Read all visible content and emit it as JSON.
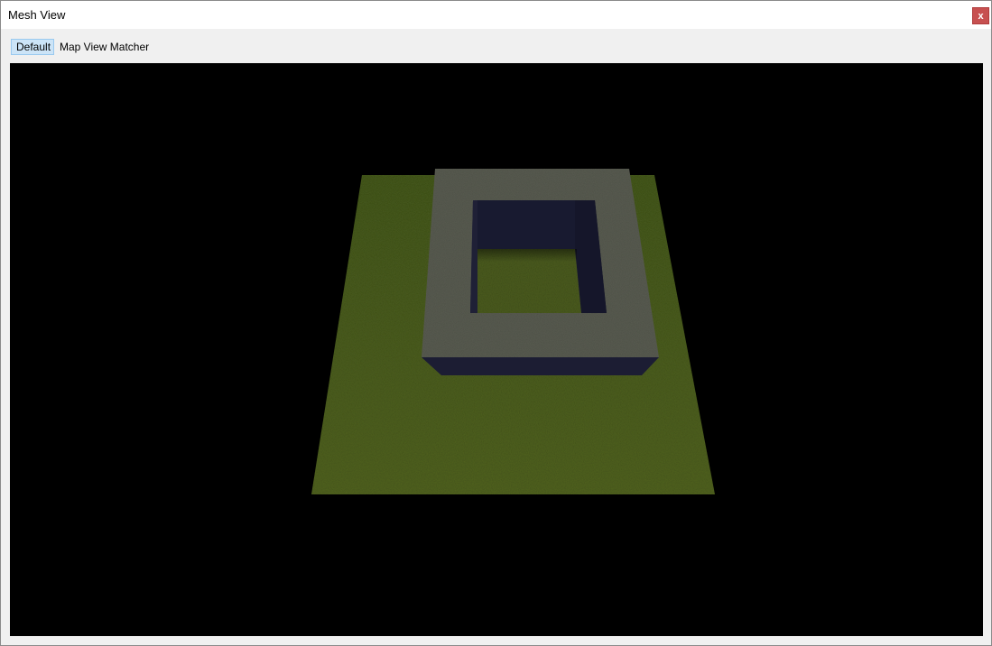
{
  "window": {
    "title": "Mesh View",
    "close_label": "x"
  },
  "tabs": [
    {
      "label": "Default",
      "active": true
    },
    {
      "label": "Map View Matcher",
      "active": false
    }
  ],
  "viewport": {
    "background": "#000000",
    "colors": {
      "grass": "#4a5a1e",
      "grass_dark": "#34421a",
      "wall_top": "#5a5d52",
      "wall_side": "#1c1d33",
      "wall_inner": "#15162a"
    }
  }
}
